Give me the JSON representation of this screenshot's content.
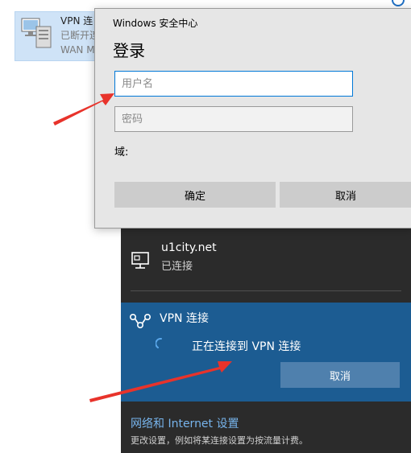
{
  "background_window": {
    "connection": {
      "name": "VPN 连",
      "status": "已断开连",
      "device": "WAN M"
    },
    "icons": {
      "connection": "network-computer-icon",
      "corner": "blue-circle-icon"
    }
  },
  "dialog": {
    "title": "Windows 安全中心",
    "heading": "登录",
    "username_placeholder": "用户名",
    "password_placeholder": "密码",
    "domain_label": "域:",
    "ok_label": "确定",
    "cancel_label": "取消"
  },
  "flyout": {
    "network": {
      "name": "u1city.net",
      "status": "已连接",
      "icon": "ethernet-monitor-icon"
    },
    "vpn": {
      "title": "VPN 连接",
      "connecting_text": "正在连接到 VPN 连接",
      "cancel_label": "取消",
      "icon": "vpn-icon"
    },
    "settings": {
      "link": "网络和 Internet 设置",
      "description": "更改设置，例如将某连接设置为按流量计费。"
    }
  },
  "annotation": {
    "arrow_color": "#e8332b"
  },
  "colors": {
    "flyout_bg": "#2b2b2b",
    "vpn_panel": "#1c5c92",
    "vpn_cancel": "#4f80ad",
    "link": "#77b4ec",
    "focus": "#0078d7",
    "dialog_bg": "#e6e6e6"
  }
}
